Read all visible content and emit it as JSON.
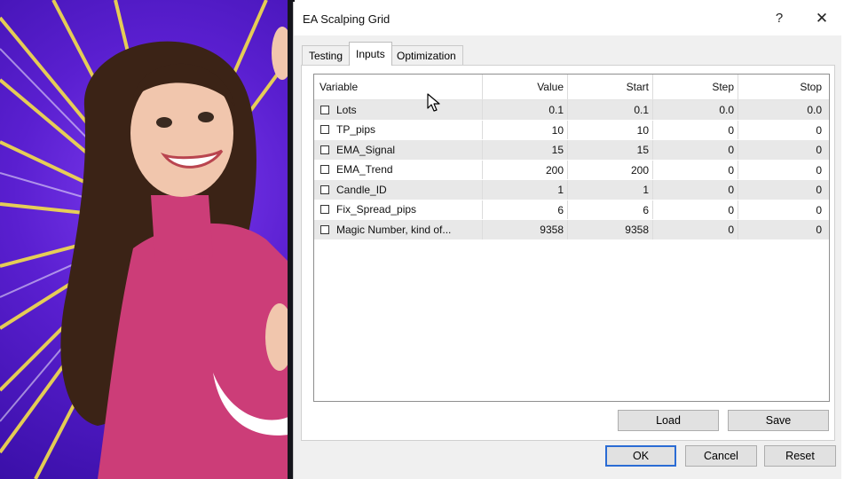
{
  "window": {
    "title": "EA Scalping Grid",
    "help_glyph": "?",
    "close_glyph": "✕"
  },
  "tabs": [
    {
      "label": "Testing",
      "active": false
    },
    {
      "label": "Inputs",
      "active": true
    },
    {
      "label": "Optimization",
      "active": false
    }
  ],
  "grid": {
    "columns": [
      "Variable",
      "Value",
      "Start",
      "Step",
      "Stop"
    ],
    "rows": [
      {
        "name": "Lots",
        "value": "0.1",
        "start": "0.1",
        "step": "0.0",
        "stop": "0.0",
        "checked": false
      },
      {
        "name": "TP_pips",
        "value": "10",
        "start": "10",
        "step": "0",
        "stop": "0",
        "checked": false
      },
      {
        "name": "EMA_Signal",
        "value": "15",
        "start": "15",
        "step": "0",
        "stop": "0",
        "checked": false
      },
      {
        "name": "EMA_Trend",
        "value": "200",
        "start": "200",
        "step": "0",
        "stop": "0",
        "checked": false
      },
      {
        "name": "Candle_ID",
        "value": "1",
        "start": "1",
        "step": "0",
        "stop": "0",
        "checked": false
      },
      {
        "name": "Fix_Spread_pips",
        "value": "6",
        "start": "6",
        "step": "0",
        "stop": "0",
        "checked": false
      },
      {
        "name": "Magic Number, kind of...",
        "value": "9358",
        "start": "9358",
        "step": "0",
        "stop": "0",
        "checked": false
      }
    ]
  },
  "buttons": {
    "load": "Load",
    "save": "Save",
    "ok": "OK",
    "cancel": "Cancel",
    "reset": "Reset"
  },
  "colors": {
    "promo_background": "#5a1fd0",
    "ray_color": "#f5e04a",
    "sweater": "#cc3d78",
    "default_button_border": "#2b6cd4"
  }
}
